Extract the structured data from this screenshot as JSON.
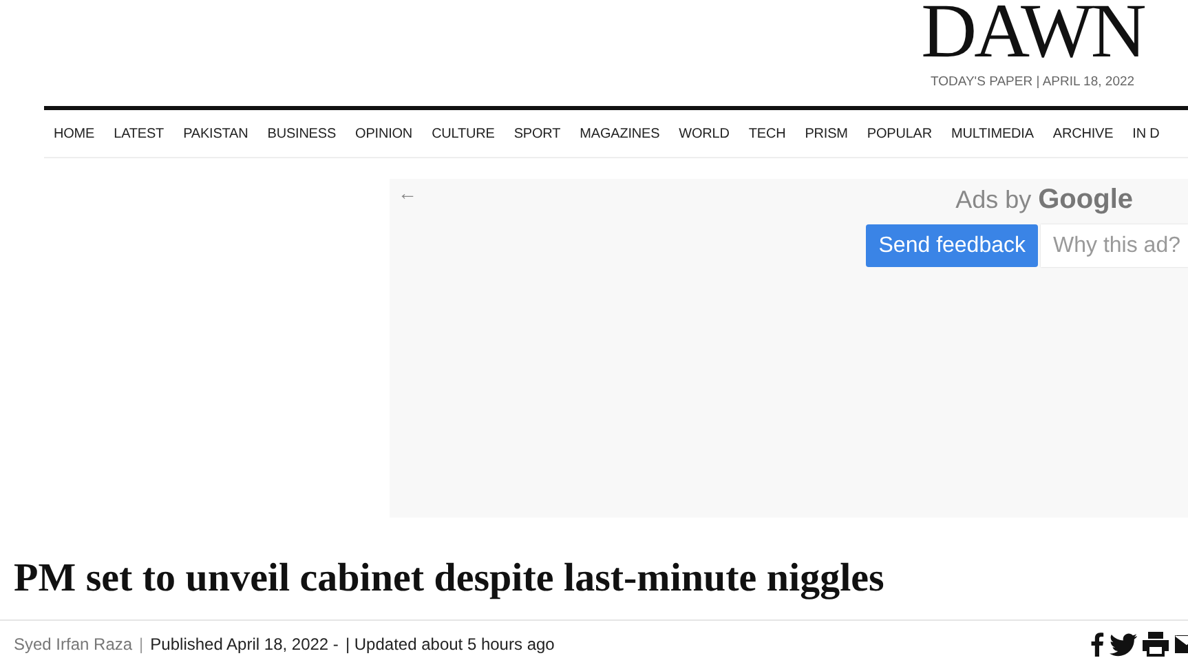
{
  "masthead": {
    "logo": "DAWN",
    "edition": "TODAY'S PAPER | APRIL 18, 2022"
  },
  "nav": {
    "items": [
      "HOME",
      "LATEST",
      "PAKISTAN",
      "BUSINESS",
      "OPINION",
      "CULTURE",
      "SPORT",
      "MAGAZINES",
      "WORLD",
      "TECH",
      "PRISM",
      "POPULAR",
      "MULTIMEDIA",
      "ARCHIVE",
      "IN D"
    ]
  },
  "ad": {
    "back": "←",
    "attribution": "Ads by",
    "brand": "Google",
    "buttons": [
      {
        "label": "Send feedback",
        "kind": "primary"
      },
      {
        "label": "Why this ad?",
        "kind": "secondary"
      }
    ]
  },
  "article": {
    "headline": "PM set to unveil cabinet despite last-minute niggles",
    "author": "Syed Irfan Raza",
    "separator": "|",
    "published": "Published April 18, 2022 -",
    "updated": "| Updated about 5 hours ago",
    "share": [
      {
        "kind": "facebook"
      },
      {
        "kind": "twitter"
      },
      {
        "kind": "print"
      },
      {
        "kind": "mail"
      }
    ]
  }
}
